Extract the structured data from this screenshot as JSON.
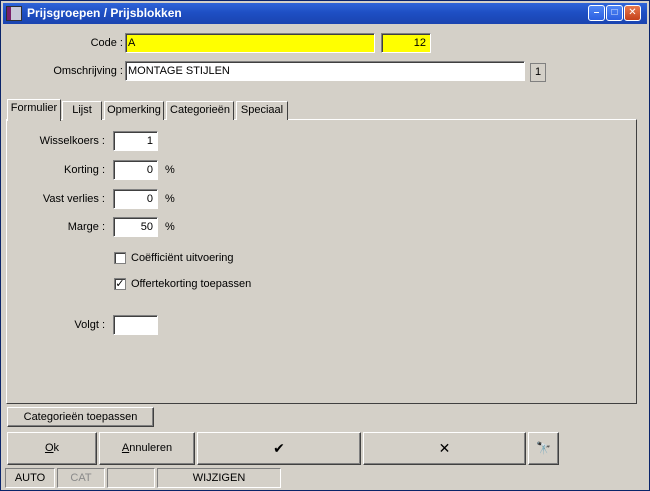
{
  "window": {
    "title": "Prijsgroepen / Prijsblokken",
    "minimize": "–",
    "maximize": "□",
    "close": "✕"
  },
  "header": {
    "code_label": "Code :",
    "code_value": "A",
    "code_number": "12",
    "description_label": "Omschrijving :",
    "description_value": "MONTAGE STIJLEN",
    "description_count": "1"
  },
  "tabs": [
    {
      "label": "Formulier",
      "active": true
    },
    {
      "label": "Lijst",
      "active": false
    },
    {
      "label": "Opmerking",
      "active": false
    },
    {
      "label": "Categorieën",
      "active": false
    },
    {
      "label": "Speciaal",
      "active": false
    }
  ],
  "form": {
    "wisselkoers_label": "Wisselkoers :",
    "wisselkoers_value": "1",
    "korting_label": "Korting :",
    "korting_value": "0",
    "korting_unit": "%",
    "vast_verlies_label": "Vast verlies :",
    "vast_verlies_value": "0",
    "vast_verlies_unit": "%",
    "marge_label": "Marge :",
    "marge_value": "50",
    "marge_unit": "%",
    "coefficient_label": "Coëfficiënt uitvoering",
    "coefficient_checked": false,
    "offertekorting_label": "Offertekorting toepassen",
    "offertekorting_checked": true,
    "volgt_label": "Volgt :",
    "volgt_value": ""
  },
  "buttons": {
    "apply_categories": "Categorieën toepassen",
    "ok": "Ok",
    "cancel": "Annuleren",
    "confirm_glyph": "✔",
    "delete_glyph": "✕",
    "search_glyph": "🔭"
  },
  "status": {
    "mode": "AUTO",
    "cat": "CAT",
    "empty": "",
    "action": "WIJZIGEN"
  }
}
